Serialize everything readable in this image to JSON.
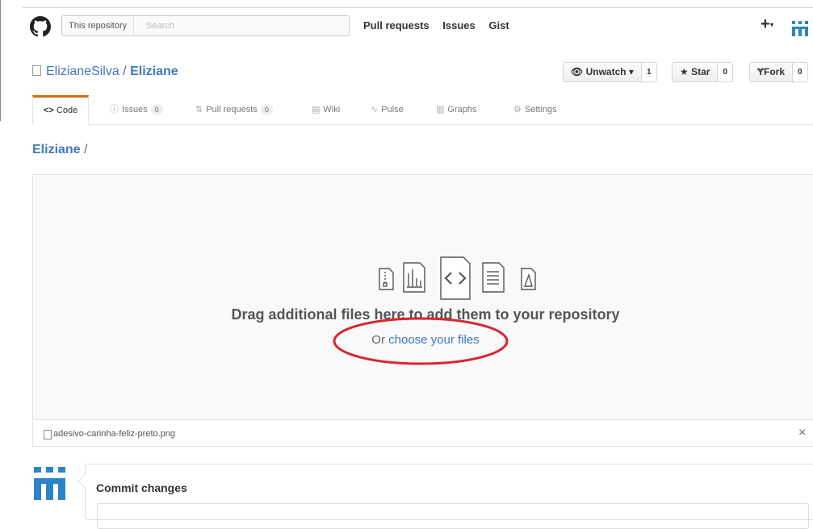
{
  "header": {
    "search_scope": "This repository",
    "search_placeholder": "Search",
    "nav": [
      "Pull requests",
      "Issues",
      "Gist"
    ],
    "plus": "+",
    "plus_caret": "▾"
  },
  "repo": {
    "owner": "ElizianeSilva",
    "separator": "/",
    "name": "Eliziane"
  },
  "actions": {
    "unwatch_label": "Unwatch ▾",
    "unwatch_count": "1",
    "star_label": "Star",
    "star_count": "0",
    "fork_label": "Fork",
    "fork_count": "0"
  },
  "tabs": [
    {
      "label": "Code",
      "icon": "code-icon"
    },
    {
      "label": "Issues",
      "count": "0",
      "icon": "issue-icon"
    },
    {
      "label": "Pull requests",
      "count": "0",
      "icon": "pull-request-icon"
    },
    {
      "label": "Wiki",
      "icon": "book-icon"
    },
    {
      "label": "Pulse",
      "icon": "pulse-icon"
    },
    {
      "label": "Graphs",
      "icon": "graph-icon"
    },
    {
      "label": "Settings",
      "icon": "gear-icon"
    }
  ],
  "breadcrumb": {
    "repo": "Eliziane",
    "slash": "/"
  },
  "dropzone": {
    "heading": "Drag additional files here to add them to your repository",
    "or_text": "Or ",
    "choose_link": "choose your files"
  },
  "file": {
    "name": "adesivo-carinha-feliz-preto.png",
    "remove": "×"
  },
  "commit": {
    "title": "Commit changes"
  },
  "colors": {
    "link": "#4078c0",
    "active_tab": "#d26911",
    "highlight": "#d9262c",
    "avatar": "#2b84c6"
  }
}
